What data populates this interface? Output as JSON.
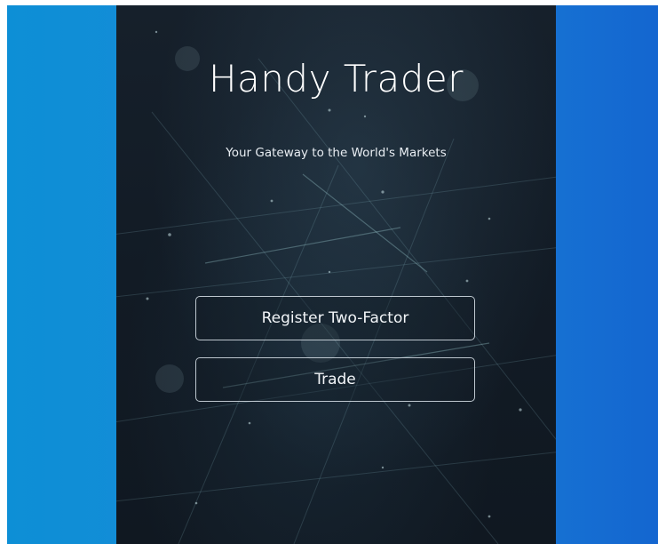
{
  "app": {
    "title": "Handy Trader",
    "tagline": "Your Gateway to the World's Markets"
  },
  "actions": {
    "register_label": "Register Two-Factor",
    "trade_label": "Trade"
  },
  "colors": {
    "backdrop_left": "#0d8fd6",
    "backdrop_right": "#1466d0",
    "panel_bg": "#121b25",
    "text": "#ffffff",
    "button_border": "#dce4ec"
  }
}
